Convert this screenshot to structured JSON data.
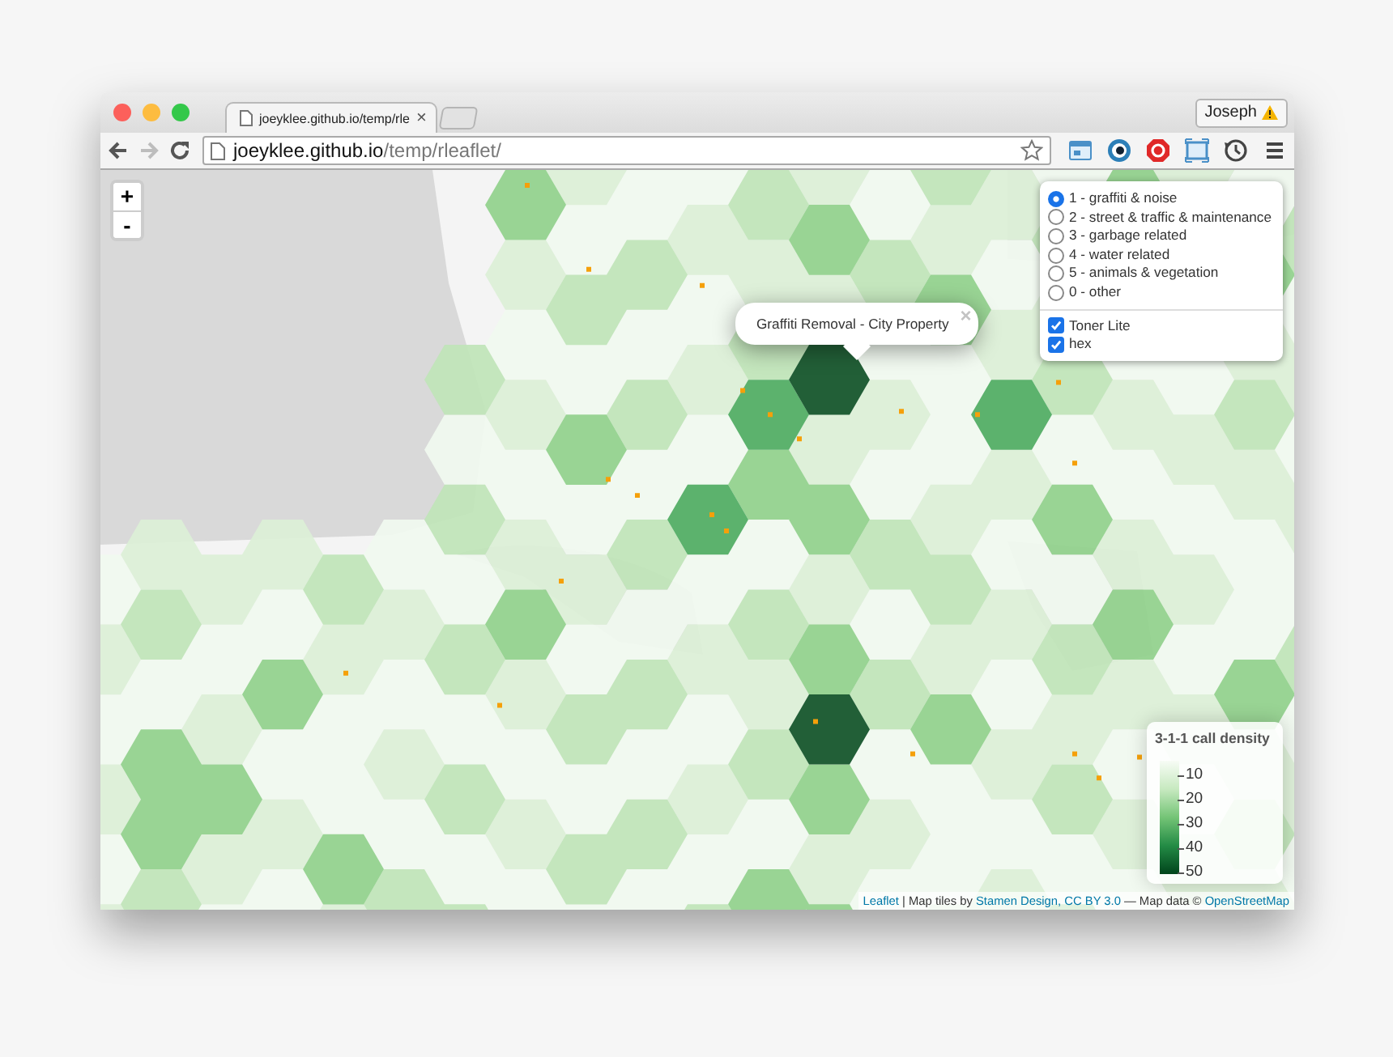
{
  "window": {
    "tabs": [
      {
        "title": "joeyklee.github.io/temp/rle",
        "close": "×",
        "selected": true
      }
    ],
    "profile": {
      "name": "Joseph",
      "warning": true
    }
  },
  "toolbar": {
    "back": {
      "disabled": false
    },
    "forward": {
      "disabled": true
    },
    "address": {
      "host": "joeyklee.github.io",
      "path": "/temp/rleaflet/"
    },
    "bookmarked": false
  },
  "map": {
    "zoom": {
      "in": "+",
      "out": "-"
    },
    "layers": {
      "base": [
        {
          "label": "1 - graffiti & noise",
          "selected": true
        },
        {
          "label": "2 - street & traffic & maintenance",
          "selected": false
        },
        {
          "label": "3 - garbage related",
          "selected": false
        },
        {
          "label": "4 - water related",
          "selected": false
        },
        {
          "label": "5 - animals & vegetation",
          "selected": false
        },
        {
          "label": "0 - other",
          "selected": false
        }
      ],
      "overlays": [
        {
          "label": "Toner Lite",
          "checked": true
        },
        {
          "label": "hex",
          "checked": true
        }
      ]
    },
    "popup": {
      "text": "Graffiti Removal - City Property",
      "close": "×"
    },
    "legend": {
      "title": "3-1-1 call density",
      "labels": [
        "10",
        "20",
        "30",
        "40",
        "50"
      ]
    },
    "attribution": [
      {
        "kind": "link",
        "text": "Leaflet"
      },
      {
        "kind": "text",
        "text": " | Map tiles by "
      },
      {
        "kind": "link",
        "text": "Stamen Design,"
      },
      {
        "kind": "link",
        "text": "CC BY 3.0"
      },
      {
        "kind": "text",
        "text": " — Map data © "
      },
      {
        "kind": "link",
        "text": "OpenStreetMap"
      }
    ]
  }
}
